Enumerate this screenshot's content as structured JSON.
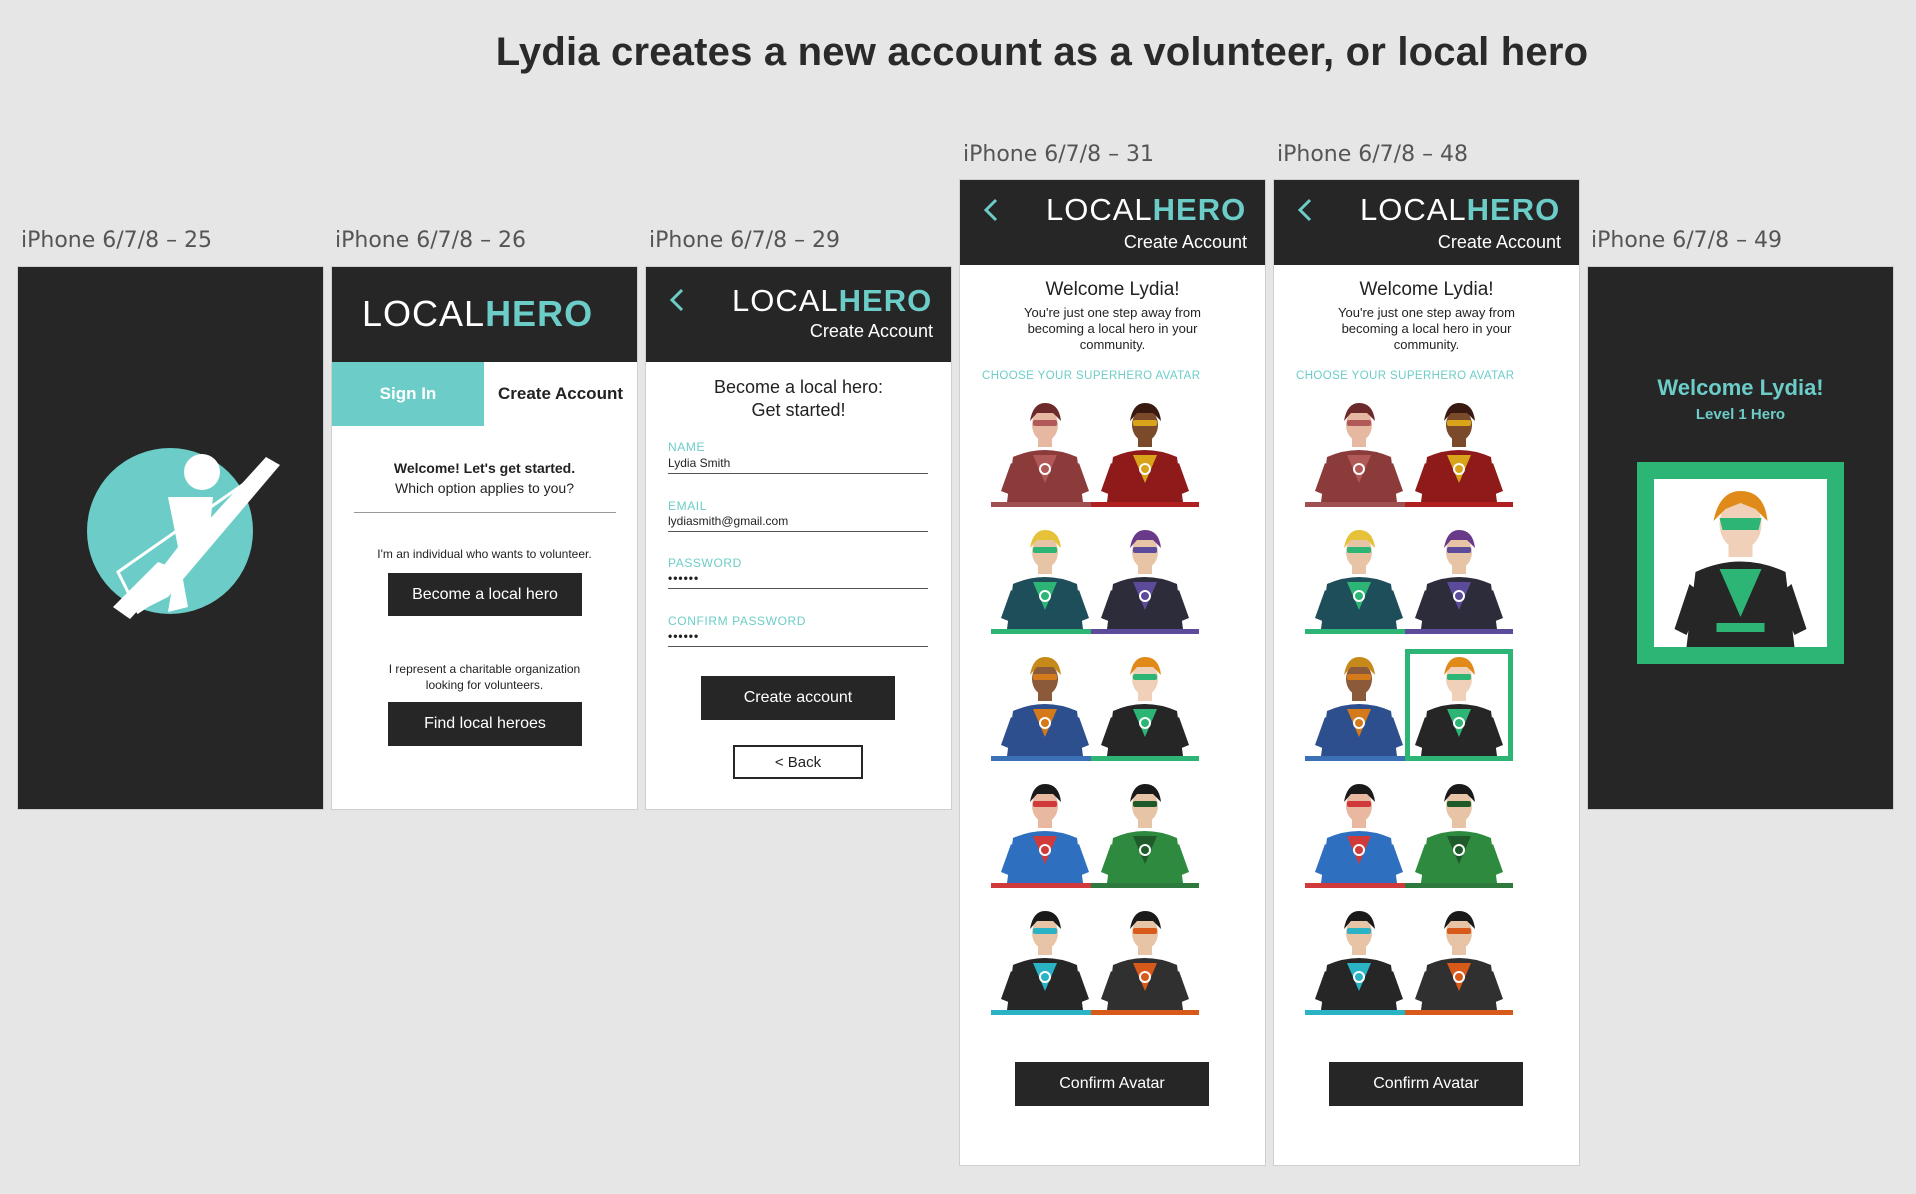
{
  "title": "Lydia creates a new account as a volunteer, or local hero",
  "logo": {
    "local": "LOCAL",
    "hero": "HERO"
  },
  "artboards": [
    {
      "label": "iPhone 6/7/8 – 25"
    },
    {
      "label": "iPhone 6/7/8 – 26"
    },
    {
      "label": "iPhone 6/7/8 – 29"
    },
    {
      "label": "iPhone 6/7/8 – 31"
    },
    {
      "label": "iPhone 6/7/8 – 48"
    },
    {
      "label": "iPhone 6/7/8 – 49"
    }
  ],
  "signin": {
    "tab_signin": "Sign In",
    "tab_create": "Create Account",
    "welcome_line1": "Welcome! Let's get started.",
    "welcome_line2": "Which option applies to you?",
    "volunteer_text": "I'm an individual who wants to volunteer.",
    "volunteer_button": "Become a local hero",
    "org_line1": "I represent a charitable organization",
    "org_line2": "looking for volunteers.",
    "org_button": "Find local heroes"
  },
  "create": {
    "header_sub": "Create Account",
    "heading_line1": "Become a local hero:",
    "heading_line2": "Get started!",
    "name_label": "NAME",
    "name_value": "Lydia Smith",
    "email_label": "EMAIL",
    "email_value": "lydiasmith@gmail.com",
    "password_label": "PASSWORD",
    "password_value": "••••••",
    "confirm_label": "CONFIRM PASSWORD",
    "confirm_value": "••••••",
    "create_button": "Create account",
    "back_button": "< Back"
  },
  "avatar_screen": {
    "header_sub": "Create Account",
    "welcome": "Welcome Lydia!",
    "line1": "You're just one step away from",
    "line2": "becoming a local hero in your",
    "line3": "community.",
    "choose_label": "CHOOSE YOUR SUPERHERO AVATAR",
    "confirm_button": "Confirm Avatar",
    "avatars": [
      {
        "name": "maroon-hero",
        "suit": "#8c3b3b",
        "accent": "#b15959",
        "skin": "#e6b8a2",
        "hair": "#6d2a2a",
        "bar": "#a05050"
      },
      {
        "name": "red-hero",
        "suit": "#8f1a1a",
        "accent": "#d9a31a",
        "skin": "#7a4a2a",
        "hair": "#3a1a10",
        "bar": "#b02020"
      },
      {
        "name": "teal-green-hero",
        "suit": "#1e4e5a",
        "accent": "#2db575",
        "skin": "#e8c4a6",
        "hair": "#e6c23a",
        "bar": "#2db575"
      },
      {
        "name": "purple-hero",
        "suit": "#2c2c3a",
        "accent": "#5c4b9a",
        "skin": "#e8c4a6",
        "hair": "#6a3a8a",
        "bar": "#5c4b9a"
      },
      {
        "name": "blue-caped-hero",
        "suit": "#2d4f8e",
        "accent": "#d47a1a",
        "skin": "#8a5a3a",
        "hair": "#c58a1a",
        "bar": "#3b6fb6"
      },
      {
        "name": "green-orange-hero",
        "suit": "#262626",
        "accent": "#2db575",
        "skin": "#f0d0b8",
        "hair": "#e08a1a",
        "bar": "#2db575"
      },
      {
        "name": "red-blue-hero",
        "suit": "#2f6fc0",
        "accent": "#d03a3a",
        "skin": "#e8b8a0",
        "hair": "#1a1a1a",
        "bar": "#d03a3a"
      },
      {
        "name": "green-hero",
        "suit": "#2e8a3e",
        "accent": "#1e5a2a",
        "skin": "#e8c4a6",
        "hair": "#1a1a1a",
        "bar": "#2e7a3e"
      },
      {
        "name": "cyan-hero",
        "suit": "#262626",
        "accent": "#2ab3c4",
        "skin": "#e8c4a6",
        "hair": "#1a1a1a",
        "bar": "#2ab3c4"
      },
      {
        "name": "orange-dark-hero",
        "suit": "#303030",
        "accent": "#d85a1a",
        "skin": "#e8c4a6",
        "hair": "#1a1a1a",
        "bar": "#d85a1a"
      }
    ],
    "selected_avatar": "green-orange-hero"
  },
  "final": {
    "welcome": "Welcome Lydia!",
    "level": "Level 1 Hero"
  },
  "colors": {
    "teal": "#6ccdc8",
    "dark": "#262626",
    "green_frame": "#2db575"
  }
}
